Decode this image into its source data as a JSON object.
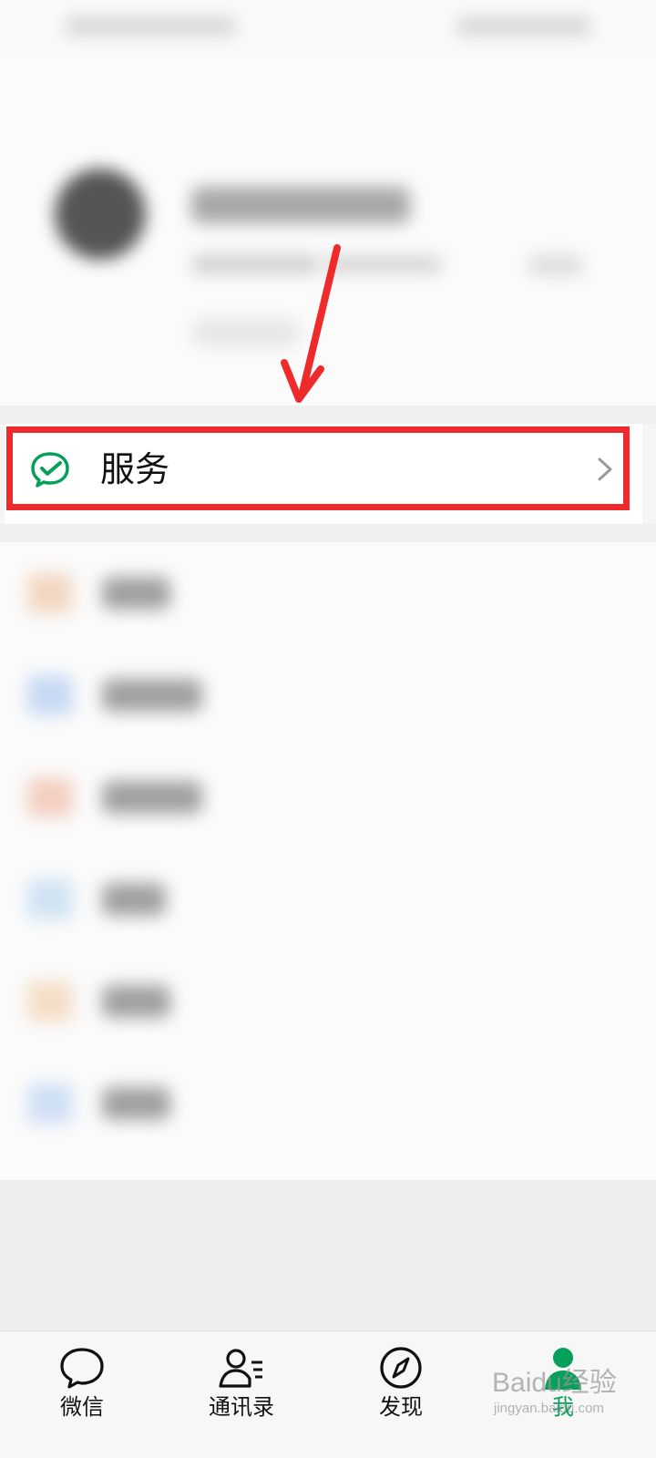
{
  "service": {
    "label": "服务"
  },
  "tabs": [
    {
      "label": "微信",
      "icon": "chat-bubble-icon"
    },
    {
      "label": "通讯录",
      "icon": "contacts-icon"
    },
    {
      "label": "发现",
      "icon": "compass-icon"
    },
    {
      "label": "我",
      "icon": "person-icon",
      "active": true
    }
  ],
  "watermark": {
    "text": "Baidu经验",
    "subtext": "jingyan.baidu.com"
  },
  "colors": {
    "accent": "#07a05a",
    "highlight_box": "#ee2a2a",
    "arrow": "#ee2a2a"
  }
}
